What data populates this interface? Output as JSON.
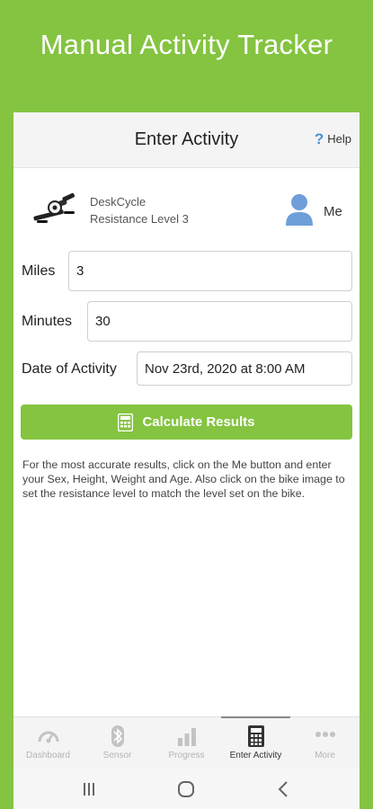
{
  "promo": {
    "title": "Manual Activity Tracker"
  },
  "header": {
    "title": "Enter Activity",
    "help_label": "Help",
    "help_icon": "question-icon"
  },
  "device": {
    "name": "DeskCycle",
    "level": "Resistance Level 3",
    "user_label": "Me"
  },
  "form": {
    "miles_label": "Miles",
    "miles_value": "3",
    "minutes_label": "Minutes",
    "minutes_value": "30",
    "date_label": "Date of Activity",
    "date_value": "Nov 23rd, 2020 at 8:00 AM"
  },
  "calculate": {
    "label": "Calculate Results",
    "icon": "calculator-icon"
  },
  "info_text": "For the most accurate results, click on the Me button and enter your Sex, Height, Weight and Age. Also click on the bike image to set the resistance level to match the level set on the bike.",
  "tabs": [
    {
      "label": "Dashboard",
      "icon": "gauge-icon",
      "active": false
    },
    {
      "label": "Sensor",
      "icon": "bluetooth-icon",
      "active": false
    },
    {
      "label": "Progress",
      "icon": "bar-chart-icon",
      "active": false
    },
    {
      "label": "Enter Activity",
      "icon": "calculator-icon",
      "active": true
    },
    {
      "label": "More",
      "icon": "more-dots-icon",
      "active": false
    }
  ],
  "colors": {
    "brand_green": "#84c440",
    "user_blue": "#6e9fd8",
    "help_blue": "#4a90d9"
  }
}
